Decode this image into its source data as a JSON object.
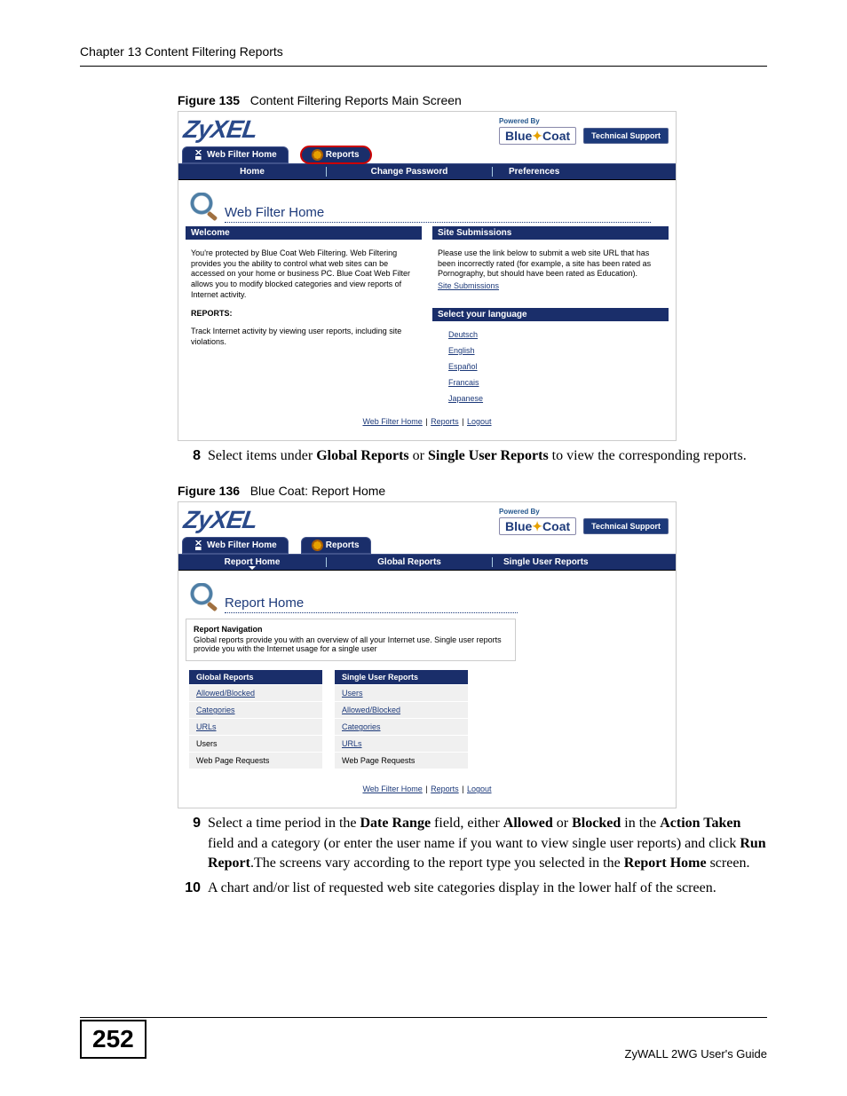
{
  "chapter_header": "Chapter 13 Content Filtering Reports",
  "fig135": {
    "num": "Figure 135",
    "title": "Content Filtering Reports Main Screen"
  },
  "fig136": {
    "num": "Figure 136",
    "title": "Blue Coat: Report Home"
  },
  "brand": {
    "logo": "ZyXEL",
    "powered_by": "Powered By",
    "bluecoat_a": "Blue",
    "bluecoat_b": "Coat",
    "tech_support": "Technical Support"
  },
  "top_tabs": {
    "home": "Web Filter Home",
    "reports": "Reports"
  },
  "ss1": {
    "subtabs": {
      "home": "Home",
      "change_pw": "Change Password",
      "prefs": "Preferences"
    },
    "page_title": "Web Filter Home",
    "welcome_hdr": "Welcome",
    "welcome_text": "You're protected by Blue Coat Web Filtering. Web Filtering provides you the ability to control what web sites can be accessed on your home or business PC. Blue Coat Web Filter allows you to modify blocked categories and view reports of Internet activity.",
    "reports_label": "REPORTS:",
    "reports_text": "Track Internet activity by viewing user reports, including site violations.",
    "subm_hdr": "Site Submissions",
    "subm_text": "Please use the link below to submit a web site URL that has been incorrectly rated (for example, a site has been rated as Pornography, but should have been rated as Education).",
    "subm_link": "Site Submissions",
    "lang_hdr": "Select your language",
    "langs": [
      "Deutsch",
      "English",
      "Español",
      "Francais",
      "Japanese"
    ]
  },
  "footer": {
    "a": "Web Filter Home",
    "b": "Reports",
    "c": "Logout",
    "sep": " | "
  },
  "step8": {
    "num": "8",
    "pre": "Select items under ",
    "b1": "Global Reports",
    "mid1": " or ",
    "b2": "Single User Reports",
    "post": " to view the corresponding reports."
  },
  "ss2": {
    "subtabs": {
      "rh": "Report Home",
      "gr": "Global Reports",
      "sur": "Single User Reports"
    },
    "page_title": "Report Home",
    "nav_hdr": "Report Navigation",
    "nav_text": "Global reports provide you with an overview of all your Internet use. Single user reports provide you with the Internet usage for a single user",
    "tblA_hdr": "Global Reports",
    "tblA": [
      {
        "label": "Allowed/Blocked",
        "link": true
      },
      {
        "label": "Categories",
        "link": true
      },
      {
        "label": "URLs",
        "link": true
      },
      {
        "label": "Users",
        "link": false
      },
      {
        "label": "Web Page Requests",
        "link": false
      }
    ],
    "tblB_hdr": "Single User Reports",
    "tblB": [
      {
        "label": "Users",
        "link": true
      },
      {
        "label": "Allowed/Blocked",
        "link": true
      },
      {
        "label": "Categories",
        "link": true
      },
      {
        "label": "URLs",
        "link": true
      },
      {
        "label": "Web Page Requests",
        "link": false
      }
    ]
  },
  "step9": {
    "num": "9",
    "p1": "Select a time period in the ",
    "b1": "Date Range",
    "p2": " field, either ",
    "b2": "Allowed",
    "p3": " or ",
    "b3": "Blocked",
    "p4": " in the ",
    "b4": "Action Taken",
    "p5": " field and a category (or enter the user name if you want to view single user reports) and click ",
    "b5": "Run Report",
    "p6": ".The screens vary according to the report type you selected in the ",
    "b6": "Report Home",
    "p7": " screen."
  },
  "step10": {
    "num": "10",
    "text": "A chart and/or list of requested web site categories display in the lower half of the screen."
  },
  "page_number": "252",
  "guide": "ZyWALL 2WG User's Guide"
}
